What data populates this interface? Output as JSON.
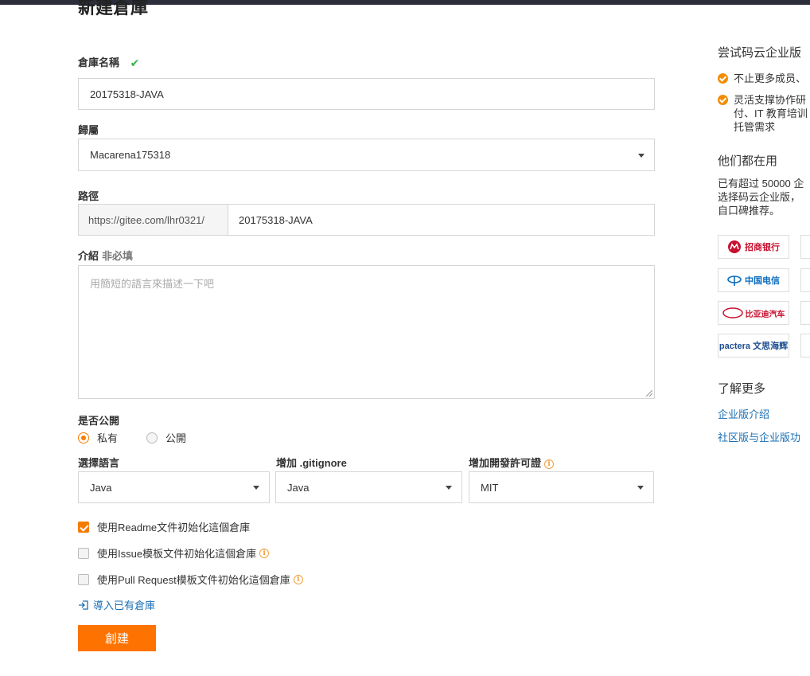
{
  "page": {
    "title": "新建倉庫"
  },
  "form": {
    "repo_name_label": "倉庫名稱",
    "repo_name_value": "20175318-JAVA",
    "owner_label": "歸屬",
    "owner_value": "Macarena175318",
    "path_label": "路徑",
    "path_prefix": "https://gitee.com/lhr0321/",
    "path_value": "20175318-JAVA",
    "intro_label": "介紹",
    "intro_optional": "非必填",
    "intro_placeholder": "用簡短的語言來描述一下吧",
    "visibility_label": "是否公開",
    "visibility_options": [
      "私有",
      "公開"
    ],
    "visibility_selected": "私有",
    "language_label": "選擇語言",
    "language_value": "Java",
    "gitignore_label": "增加 .gitignore",
    "gitignore_value": "Java",
    "license_label": "增加開發許可證",
    "license_value": "MIT",
    "checkboxes": [
      {
        "label": "使用Readme文件初始化這個倉庫",
        "checked": true
      },
      {
        "label": "使用Issue模板文件初始化這個倉庫",
        "checked": false
      },
      {
        "label": "使用Pull Request模板文件初始化這個倉庫",
        "checked": false
      }
    ],
    "import_link": "導入已有倉庫",
    "create_button": "創建"
  },
  "sidebar": {
    "promo_title": "尝试码云企业版",
    "bullets": [
      [
        "不止更多成员、"
      ],
      [
        "灵活支撑协作研",
        "付、IT 教育培训",
        "托管需求"
      ]
    ],
    "users_title": "他们都在用",
    "users_text": [
      "已有超过 50000 企",
      "选择码云企业版，",
      "自口碑推荐。"
    ],
    "logos": [
      "招商银行",
      "中国电信",
      "比亚迪汽车",
      "pactera 文思海辉"
    ],
    "learn_more_title": "了解更多",
    "links": [
      "企业版介绍",
      "社区版与企业版功"
    ]
  },
  "colors": {
    "accent": "#fe7300",
    "link": "#1a6fb3",
    "check": "#3bb04a"
  }
}
